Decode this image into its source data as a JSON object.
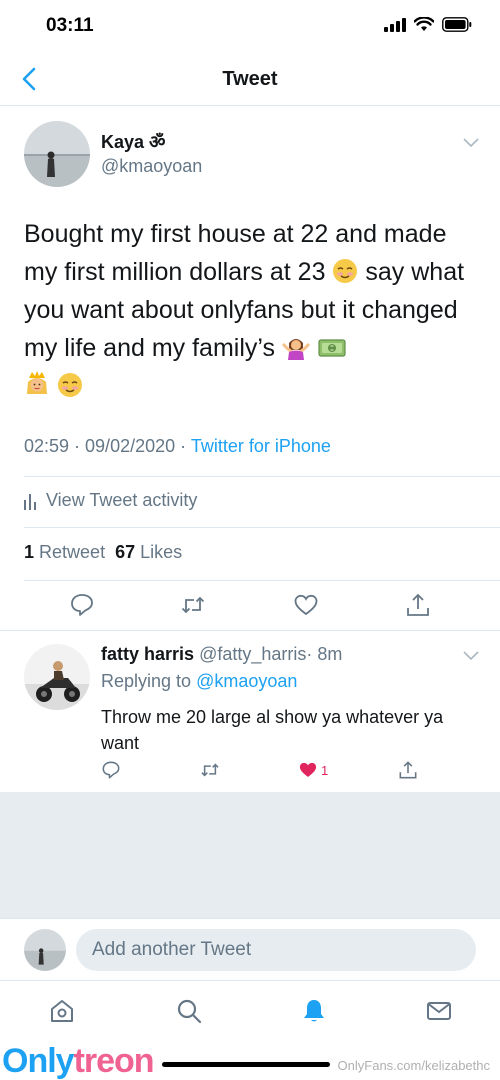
{
  "status_bar": {
    "time": "03:11"
  },
  "nav": {
    "title": "Tweet"
  },
  "tweet": {
    "author_name": "Kaya ॐ",
    "author_handle": "@kmaoyoan",
    "text_1": "Bought my first house at 22 and made my first million dollars at 23 ",
    "text_2": " say what you want about onlyfans but it changed my life and my family’s ",
    "timestamp": "02:59 · 09/02/2020 · ",
    "source": "Twitter for iPhone",
    "activity_label": "View Tweet activity",
    "retweet_count": "1",
    "retweet_label": "Retweet",
    "like_count": "67",
    "like_label": "Likes"
  },
  "reply": {
    "author_name": "fatty harris",
    "author_handle": "@fatty_harris",
    "time": "· 8m",
    "replying_prefix": "Replying to ",
    "replying_to": "@kmaoyoan",
    "text": "Throw me 20 large al show ya whatever ya want",
    "like_count": "1"
  },
  "compose": {
    "placeholder": "Add another Tweet"
  },
  "footer": {
    "brand_part1": "Only",
    "brand_part2": "treon",
    "watermark": "OnlyFans.com/kelizabethc"
  },
  "colors": {
    "accent": "#1da1f2",
    "like": "#e0245e",
    "muted": "#657786",
    "divider": "#e1e8ed"
  }
}
